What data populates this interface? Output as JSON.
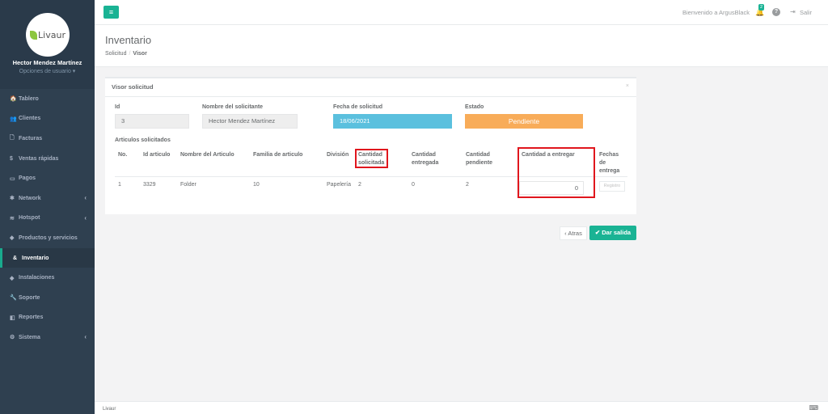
{
  "sidebar": {
    "logo_text": "Livaur",
    "user_name": "Hector Mendez Martínez",
    "user_options": "Opciones de usuario ▾",
    "items": [
      {
        "label": "Tablero",
        "icon": "🏠"
      },
      {
        "label": "Clientes",
        "icon": "👥"
      },
      {
        "label": "Facturas",
        "icon": "🗋"
      },
      {
        "label": "Ventas rápidas",
        "icon": "$"
      },
      {
        "label": "Pagos",
        "icon": "▭"
      },
      {
        "label": "Network",
        "icon": "✱",
        "chevron": "‹"
      },
      {
        "label": "Hotspot",
        "icon": "≋",
        "chevron": "‹"
      },
      {
        "label": "Productos y servicios",
        "icon": "◆"
      },
      {
        "label": "Inventario",
        "icon": "&"
      },
      {
        "label": "Instalaciones",
        "icon": "◆"
      },
      {
        "label": "Soporte",
        "icon": "🔧"
      },
      {
        "label": "Reportes",
        "icon": "◧"
      },
      {
        "label": "Sistema",
        "icon": "⚙",
        "chevron": "‹"
      }
    ]
  },
  "topbar": {
    "menu_icon": "≡",
    "welcome": "Bienvenido a ArgusBlack",
    "notif_count": "2",
    "logout": "Salir"
  },
  "page": {
    "title": "Inventario",
    "breadcrumb_parent": "Solicitud",
    "breadcrumb_sep": "/",
    "breadcrumb_current": "Visor"
  },
  "panel": {
    "title": "Visor solicitud",
    "close": "×",
    "fields": {
      "id_label": "Id",
      "id_value": "3",
      "requester_label": "Nombre del solicitante",
      "requester_value": "Hector Mendez Martínez",
      "date_label": "Fecha de solicitud",
      "date_value": "18/06/2021",
      "status_label": "Estado",
      "status_value": "Pendiente"
    },
    "section_title": "Articulos solicitados",
    "columns": [
      "No.",
      "Id articulo",
      "Nombre del Articulo",
      "Familia de articulo",
      "División",
      "Cantidad solicitada",
      "Cantidad entregada",
      "Cantidad pendiente",
      "Cantidad a entregar",
      "Fechas de entrega"
    ],
    "rows": [
      {
        "no": "1",
        "id": "3329",
        "name": "Folder",
        "family": "10",
        "division": "Papelería",
        "requested": "2",
        "delivered": "0",
        "pending": "2",
        "to_deliver": "0",
        "action": "Registro"
      }
    ]
  },
  "actions": {
    "back": "‹ Atras",
    "dispatch": "✔ Dar salida"
  },
  "footer": {
    "text": "Livaur"
  },
  "colors": {
    "sidebar": "#2f4050",
    "accent": "#1ab394",
    "date_box": "#5bc0de",
    "status_box": "#f8ac59",
    "highlight": "#e0161d"
  }
}
